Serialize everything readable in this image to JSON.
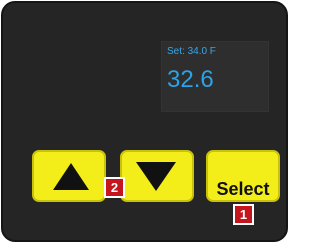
{
  "display": {
    "setpoint": "Set: 34.0 F",
    "current_temp": "32.6"
  },
  "buttons": {
    "up_icon": "triangle-up-icon",
    "down_icon": "triangle-down-icon",
    "select_label": "Select"
  },
  "badges": {
    "buttons_up_down": "2",
    "button_select": "1"
  },
  "colors": {
    "panel": "#252525",
    "screen": "#2e2e2e",
    "display_text": "#29a3ea",
    "button": "#f3ee1a",
    "badge": "#c4161c"
  }
}
